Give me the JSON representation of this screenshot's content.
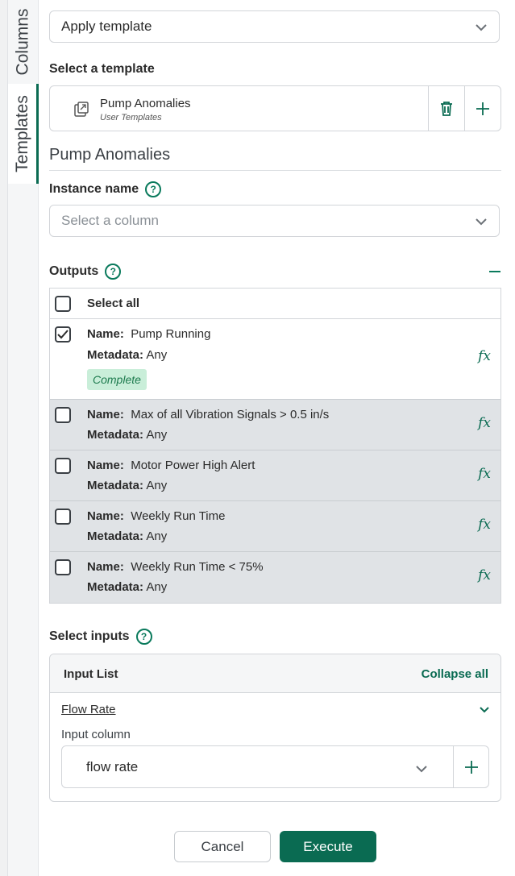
{
  "tabs": {
    "columns": "Columns",
    "templates": "Templates"
  },
  "action_dropdown": {
    "value": "Apply template",
    "icon": "chevron-down-icon"
  },
  "select_template": {
    "label": "Select a template",
    "selected": {
      "name": "Pump Anomalies",
      "source": "User Templates",
      "icon": "template-icon"
    },
    "icons": [
      "trash-icon",
      "plus-icon"
    ]
  },
  "template_title": "Pump Anomalies",
  "instance": {
    "label": "Instance name",
    "placeholder": "Select a column"
  },
  "outputs": {
    "label": "Outputs",
    "select_all": "Select all",
    "name_key": "Name:",
    "metadata_key": "Metadata:",
    "rows": [
      {
        "name": "Pump Running",
        "metadata": "Any",
        "checked": true,
        "status": "Complete"
      },
      {
        "name": "Max of all Vibration Signals > 0.5 in/s",
        "metadata": "Any",
        "checked": false
      },
      {
        "name": "Motor Power High Alert",
        "metadata": "Any",
        "checked": false
      },
      {
        "name": "Weekly Run Time",
        "metadata": "Any",
        "checked": false
      },
      {
        "name": "Weekly Run Time < 75%",
        "metadata": "Any",
        "checked": false
      }
    ],
    "fx_symbol": "fx"
  },
  "inputs": {
    "label": "Select inputs",
    "list_title": "Input List",
    "collapse_all": "Collapse all",
    "item": {
      "name": "Flow Rate",
      "column_label": "Input column",
      "column_value": "flow rate"
    }
  },
  "buttons": {
    "cancel": "Cancel",
    "execute": "Execute"
  },
  "colors": {
    "accent": "#0a6b52",
    "badge_bg": "#c9eed9",
    "unselected_row": "#e0e3e6"
  }
}
